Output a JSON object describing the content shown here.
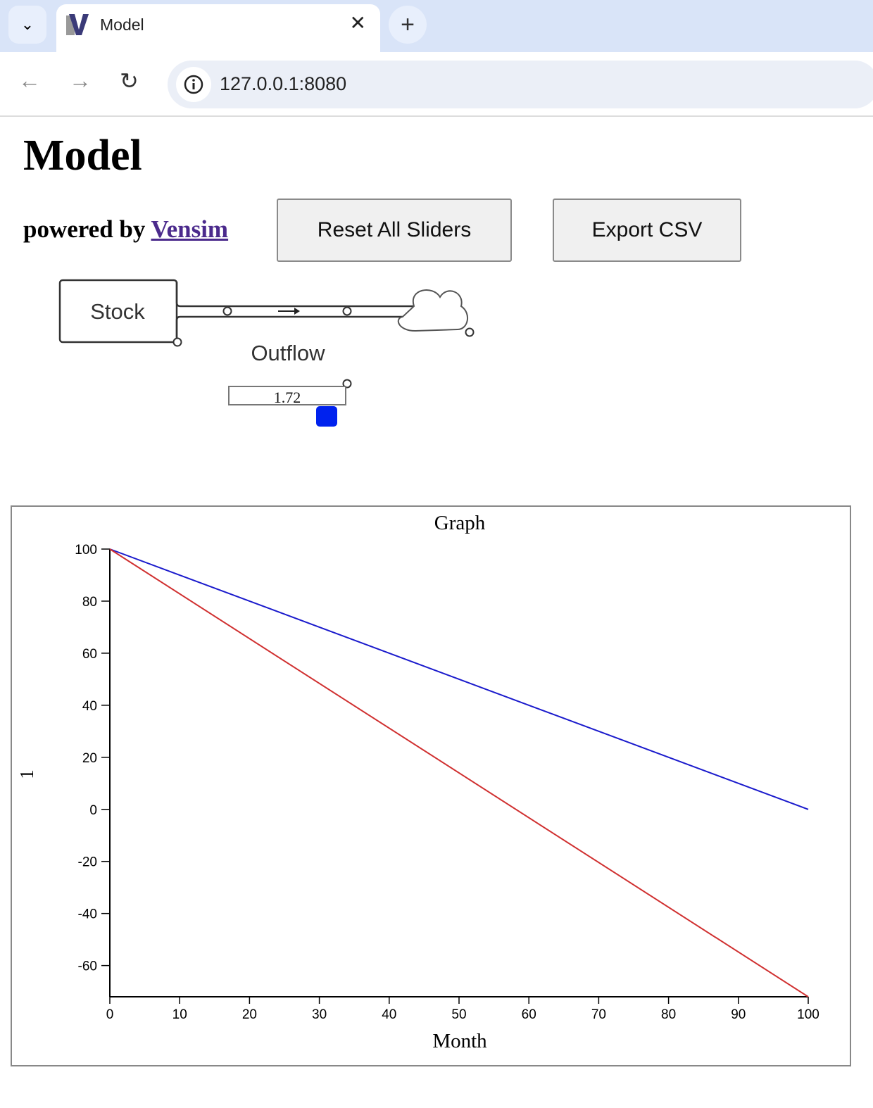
{
  "browser": {
    "tab_title": "Model",
    "url": "127.0.0.1:8080",
    "icons": [
      "chevron-down-icon",
      "vensim-favicon",
      "close-icon",
      "plus-icon",
      "back-icon",
      "forward-icon",
      "reload-icon",
      "info-icon"
    ]
  },
  "page": {
    "title": "Model",
    "powered_prefix": "powered by ",
    "powered_link": "Vensim",
    "reset_label": "Reset All Sliders",
    "export_label": "Export CSV"
  },
  "diagram": {
    "stock_label": "Stock",
    "flow_label": "Outflow",
    "slider_value": "1.72",
    "slider_color": "#0022ee"
  },
  "chart_data": {
    "type": "line",
    "title": "Graph",
    "xlabel": "Month",
    "ylabel": "1",
    "xlim": [
      0,
      100
    ],
    "ylim": [
      -72,
      100
    ],
    "xticks": [
      0,
      10,
      20,
      30,
      40,
      50,
      60,
      70,
      80,
      90,
      100
    ],
    "yticks": [
      100,
      80,
      60,
      40,
      20,
      0,
      -20,
      -40,
      -60
    ],
    "series": [
      {
        "color": "#1a1acc",
        "x": [
          0,
          100
        ],
        "y": [
          100,
          0
        ]
      },
      {
        "color": "#d03030",
        "x": [
          0,
          100
        ],
        "y": [
          100,
          -72
        ]
      }
    ],
    "grid": false
  }
}
